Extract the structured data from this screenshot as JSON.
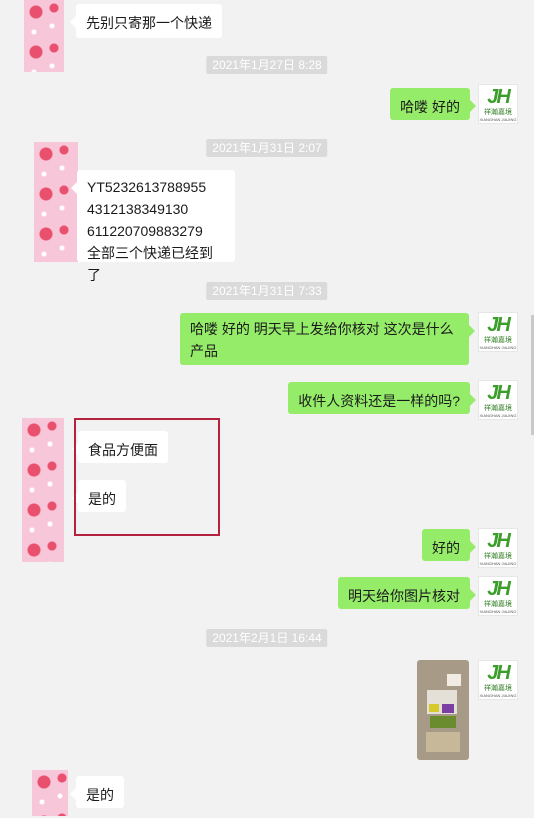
{
  "timestamps": [
    "2021年1月27日 8:28",
    "2021年1月31日 2:07",
    "2021年1月31日 7:33",
    "2021年2月1日 16:44"
  ],
  "messages": {
    "m0": "先别只寄那一个快递",
    "m1": "哈喽 好的",
    "m2_line1": "YT5232613788955",
    "m2_line2": "4312138349130",
    "m2_line3": "611220709883279",
    "m2_line4": "全部三个快递已经到了",
    "m3": "哈喽 好的  明天早上发给你核对   这次是什么产品",
    "m4": "收件人资料还是一样的吗?",
    "m5": "食品方便面",
    "m6": "是的",
    "m7": "好的",
    "m8": "明天给你图片核对",
    "m10": "是的"
  },
  "logo": {
    "mark": "JH",
    "text": "祥瀚嘉境",
    "sub": "XIANGHAN JIAJING"
  },
  "colors": {
    "sent_bubble": "#95ec69",
    "received_bubble": "#ffffff",
    "highlight": "#b5223f",
    "background": "#f2f2f2"
  }
}
